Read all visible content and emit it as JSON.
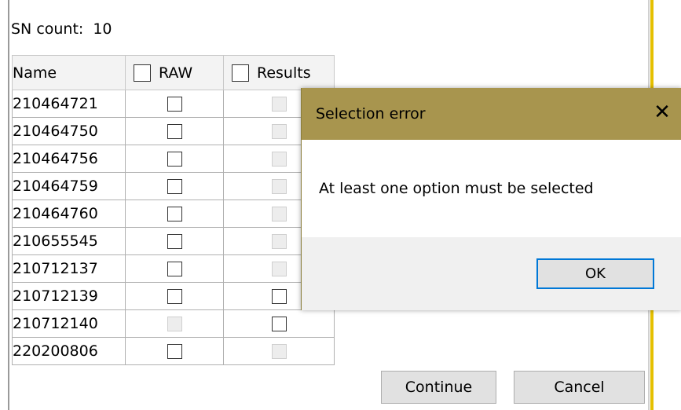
{
  "sn_count": {
    "label": "SN count:",
    "value": "10"
  },
  "table": {
    "headers": {
      "name": "Name",
      "raw": "RAW",
      "results": "Results"
    },
    "rows": [
      {
        "name": "210464721",
        "raw_enabled": true,
        "results_enabled": false
      },
      {
        "name": "210464750",
        "raw_enabled": true,
        "results_enabled": false
      },
      {
        "name": "210464756",
        "raw_enabled": true,
        "results_enabled": false
      },
      {
        "name": "210464759",
        "raw_enabled": true,
        "results_enabled": false
      },
      {
        "name": "210464760",
        "raw_enabled": true,
        "results_enabled": false
      },
      {
        "name": "210655545",
        "raw_enabled": true,
        "results_enabled": false
      },
      {
        "name": "210712137",
        "raw_enabled": true,
        "results_enabled": false
      },
      {
        "name": "210712139",
        "raw_enabled": true,
        "results_enabled": true
      },
      {
        "name": "210712140",
        "raw_enabled": false,
        "results_enabled": true
      },
      {
        "name": "220200806",
        "raw_enabled": true,
        "results_enabled": false
      }
    ]
  },
  "buttons": {
    "continue": "Continue",
    "cancel": "Cancel"
  },
  "dialog": {
    "title": "Selection error",
    "close_glyph": "✕",
    "message": "At least one option must be selected",
    "ok": "OK"
  },
  "colors": {
    "dialog_title_bg": "#a8954e",
    "window_accent": "#e5c000",
    "focus_border": "#0078d7"
  }
}
